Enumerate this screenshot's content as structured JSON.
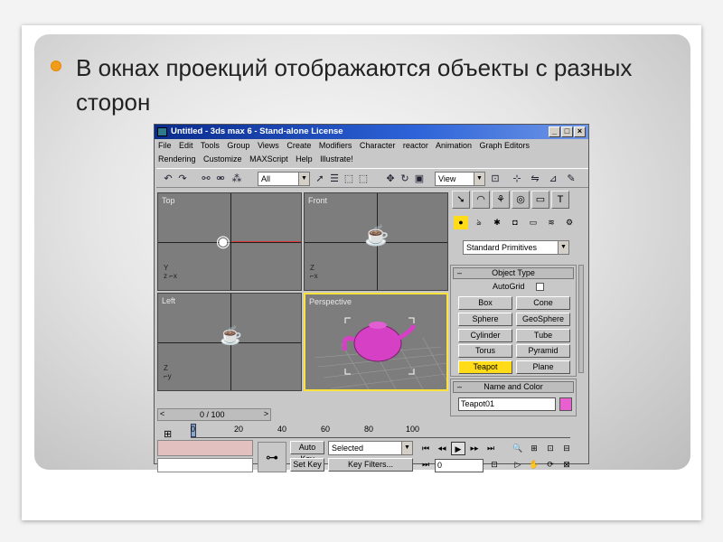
{
  "slide": {
    "bullet_text": "В окнах проекций отображаются объекты с разных сторон"
  },
  "window": {
    "title": "Untitled - 3ds max 6 - Stand-alone License",
    "controls": [
      "_",
      "□",
      "×"
    ],
    "menu_row1": [
      "File",
      "Edit",
      "Tools",
      "Group",
      "Views",
      "Create",
      "Modifiers",
      "Character",
      "reactor",
      "Animation",
      "Graph Editors"
    ],
    "menu_row2": [
      "Rendering",
      "Customize",
      "MAXScript",
      "Help",
      "Illustrate!"
    ]
  },
  "toolbar": {
    "selection_filter": "All",
    "reference_coord": "View"
  },
  "viewports": [
    {
      "label": "Top"
    },
    {
      "label": "Front"
    },
    {
      "label": "Left"
    },
    {
      "label": "Perspective"
    }
  ],
  "command_panel": {
    "category": "Standard Primitives",
    "object_type_title": "Object Type",
    "autogrid_label": "AutoGrid",
    "buttons": [
      "Box",
      "Cone",
      "Sphere",
      "GeoSphere",
      "Cylinder",
      "Tube",
      "Torus",
      "Pyramid",
      "Teapot",
      "Plane"
    ],
    "active_button": "Teapot",
    "name_color_title": "Name and Color",
    "object_name": "Teapot01",
    "object_color": "#e85fd0"
  },
  "timeline": {
    "frame_display": "0 / 100",
    "ticks": [
      "0",
      "20",
      "40",
      "60",
      "80",
      "100"
    ]
  },
  "animation": {
    "auto_key": "Auto Key",
    "set_key": "Set Key",
    "key_mode": "Selected",
    "key_filters": "Key Filters...",
    "current_frame": "0"
  },
  "colors": {
    "title_bar": "#0a2b8c",
    "active_button": "#ffdb18",
    "teapot_perspective": "#d540c4",
    "bullet": "#f29c1d"
  }
}
